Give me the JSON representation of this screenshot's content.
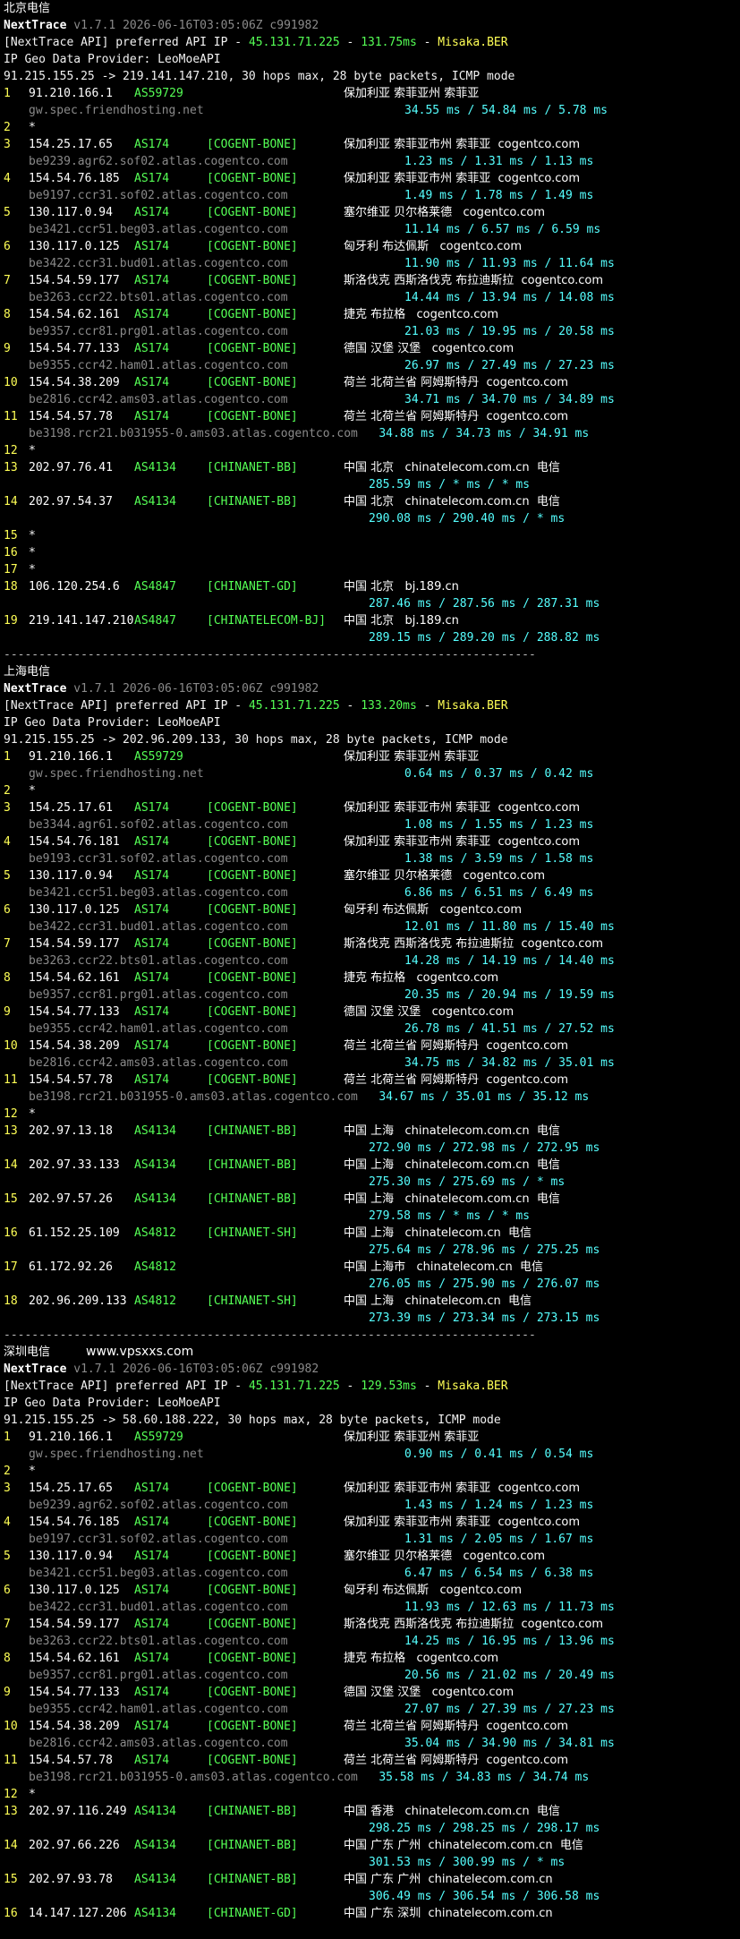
{
  "watermark": "www.vpsxxs.com",
  "sections": [
    {
      "title": "北京电信",
      "version_line": {
        "app": "NextTrace",
        "rest": " v1.7.1 2026-06-16T03:05:06Z c991982"
      },
      "api_line": {
        "prefix": "[NextTrace API]",
        "mid": " preferred API IP - ",
        "ip": "45.131.71.225",
        "dash": " - ",
        "latency": "131.75ms",
        "dash2": " - ",
        "node": "Misaka.BER"
      },
      "geo_provider": "IP Geo Data Provider: LeoMoeAPI",
      "trace_line": "91.215.155.25 -> 219.141.147.210, 30 hops max, 28 byte packets, ICMP mode",
      "hops": [
        {
          "n": "1",
          "ip": "91.210.166.1",
          "as": "AS59729",
          "tag": "",
          "geo": "保加利亚 索菲亚州 索菲亚",
          "host": "gw.spec.friendhosting.net",
          "rtt": "34.55 ms / 54.84 ms / 5.78 ms",
          "rtt_inline": false
        },
        {
          "n": "2",
          "star": "*"
        },
        {
          "n": "3",
          "ip": "154.25.17.65",
          "as": "AS174",
          "tag": "[COGENT-BONE]",
          "geo": "保加利亚 索菲亚市州 索菲亚  cogentco.com",
          "host": "be9239.agr62.sof02.atlas.cogentco.com",
          "rtt": "1.23 ms / 1.31 ms / 1.13 ms",
          "rtt_inline": false
        },
        {
          "n": "4",
          "ip": "154.54.76.185",
          "as": "AS174",
          "tag": "[COGENT-BONE]",
          "geo": "保加利亚 索菲亚市州 索菲亚  cogentco.com",
          "host": "be9197.ccr31.sof02.atlas.cogentco.com",
          "rtt": "1.49 ms / 1.78 ms / 1.49 ms",
          "rtt_inline": false
        },
        {
          "n": "5",
          "ip": "130.117.0.94",
          "as": "AS174",
          "tag": "[COGENT-BONE]",
          "geo": "塞尔维亚 贝尔格莱德   cogentco.com",
          "host": "be3421.ccr51.beg03.atlas.cogentco.com",
          "rtt": "11.14 ms / 6.57 ms / 6.59 ms",
          "rtt_inline": false
        },
        {
          "n": "6",
          "ip": "130.117.0.125",
          "as": "AS174",
          "tag": "[COGENT-BONE]",
          "geo": "匈牙利 布达佩斯   cogentco.com",
          "host": "be3422.ccr31.bud01.atlas.cogentco.com",
          "rtt": "11.90 ms / 11.93 ms / 11.64 ms",
          "rtt_inline": false
        },
        {
          "n": "7",
          "ip": "154.54.59.177",
          "as": "AS174",
          "tag": "[COGENT-BONE]",
          "geo": "斯洛伐克 西斯洛伐克 布拉迪斯拉  cogentco.com",
          "host": "be3263.ccr22.bts01.atlas.cogentco.com",
          "rtt": "14.44 ms / 13.94 ms / 14.08 ms",
          "rtt_inline": false
        },
        {
          "n": "8",
          "ip": "154.54.62.161",
          "as": "AS174",
          "tag": "[COGENT-BONE]",
          "geo": "捷克 布拉格   cogentco.com",
          "host": "be9357.ccr81.prg01.atlas.cogentco.com",
          "rtt": "21.03 ms / 19.95 ms / 20.58 ms",
          "rtt_inline": false
        },
        {
          "n": "9",
          "ip": "154.54.77.133",
          "as": "AS174",
          "tag": "[COGENT-BONE]",
          "geo": "德国 汉堡 汉堡   cogentco.com",
          "host": "be9355.ccr42.ham01.atlas.cogentco.com",
          "rtt": "26.97 ms / 27.49 ms / 27.23 ms",
          "rtt_inline": false
        },
        {
          "n": "10",
          "ip": "154.54.38.209",
          "as": "AS174",
          "tag": "[COGENT-BONE]",
          "geo": "荷兰 北荷兰省 阿姆斯特丹  cogentco.com",
          "host": "be2816.ccr42.ams03.atlas.cogentco.com",
          "rtt": "34.71 ms / 34.70 ms / 34.89 ms",
          "rtt_inline": false
        },
        {
          "n": "11",
          "ip": "154.54.57.78",
          "as": "AS174",
          "tag": "[COGENT-BONE]",
          "geo": "荷兰 北荷兰省 阿姆斯特丹  cogentco.com",
          "host": "be3198.rcr21.b031955-0.ams03.atlas.cogentco.com",
          "rtt": "34.88 ms / 34.73 ms / 34.91 ms",
          "rtt_inline": true
        },
        {
          "n": "12",
          "star": "*"
        },
        {
          "n": "13",
          "ip": "202.97.76.41",
          "as": "AS4134",
          "tag": "[CHINANET-BB]",
          "geo": "中国 北京   chinatelecom.com.cn  电信",
          "host": "",
          "rtt": "285.59 ms / * ms / * ms",
          "rtt_inline": false
        },
        {
          "n": "14",
          "ip": "202.97.54.37",
          "as": "AS4134",
          "tag": "[CHINANET-BB]",
          "geo": "中国 北京   chinatelecom.com.cn  电信",
          "host": "",
          "rtt": "290.08 ms / 290.40 ms / * ms",
          "rtt_inline": false
        },
        {
          "n": "15",
          "star": "*"
        },
        {
          "n": "16",
          "star": "*"
        },
        {
          "n": "17",
          "star": "*"
        },
        {
          "n": "18",
          "ip": "106.120.254.6",
          "as": "AS4847",
          "tag": "[CHINANET-GD]",
          "geo": "中国 北京   bj.189.cn",
          "host": "",
          "rtt": "287.46 ms / 287.56 ms / 287.31 ms",
          "rtt_inline": false
        },
        {
          "n": "19",
          "ip": "219.141.147.210",
          "as": "AS4847",
          "tag": "[CHINATELECOM-BJ]",
          "geo": "中国 北京   bj.189.cn",
          "host": "",
          "rtt": "289.15 ms / 289.20 ms / 288.82 ms",
          "rtt_inline": false
        }
      ]
    },
    {
      "title": "上海电信",
      "version_line": {
        "app": "NextTrace",
        "rest": " v1.7.1 2026-06-16T03:05:06Z c991982"
      },
      "api_line": {
        "prefix": "[NextTrace API]",
        "mid": " preferred API IP - ",
        "ip": "45.131.71.225",
        "dash": " - ",
        "latency": "133.20ms",
        "dash2": " - ",
        "node": "Misaka.BER"
      },
      "geo_provider": "IP Geo Data Provider: LeoMoeAPI",
      "trace_line": "91.215.155.25 -> 202.96.209.133, 30 hops max, 28 byte packets, ICMP mode",
      "hops": [
        {
          "n": "1",
          "ip": "91.210.166.1",
          "as": "AS59729",
          "tag": "",
          "geo": "保加利亚 索菲亚州 索菲亚",
          "host": "gw.spec.friendhosting.net",
          "rtt": "0.64 ms / 0.37 ms / 0.42 ms",
          "rtt_inline": false
        },
        {
          "n": "2",
          "star": "*"
        },
        {
          "n": "3",
          "ip": "154.25.17.61",
          "as": "AS174",
          "tag": "[COGENT-BONE]",
          "geo": "保加利亚 索菲亚市州 索菲亚  cogentco.com",
          "host": "be3344.agr61.sof02.atlas.cogentco.com",
          "rtt": "1.08 ms / 1.55 ms / 1.23 ms",
          "rtt_inline": false
        },
        {
          "n": "4",
          "ip": "154.54.76.181",
          "as": "AS174",
          "tag": "[COGENT-BONE]",
          "geo": "保加利亚 索菲亚市州 索菲亚  cogentco.com",
          "host": "be9193.ccr31.sof02.atlas.cogentco.com",
          "rtt": "1.38 ms / 3.59 ms / 1.58 ms",
          "rtt_inline": false
        },
        {
          "n": "5",
          "ip": "130.117.0.94",
          "as": "AS174",
          "tag": "[COGENT-BONE]",
          "geo": "塞尔维亚 贝尔格莱德   cogentco.com",
          "host": "be3421.ccr51.beg03.atlas.cogentco.com",
          "rtt": "6.86 ms / 6.51 ms / 6.49 ms",
          "rtt_inline": false
        },
        {
          "n": "6",
          "ip": "130.117.0.125",
          "as": "AS174",
          "tag": "[COGENT-BONE]",
          "geo": "匈牙利 布达佩斯   cogentco.com",
          "host": "be3422.ccr31.bud01.atlas.cogentco.com",
          "rtt": "12.01 ms / 11.80 ms / 15.40 ms",
          "rtt_inline": false
        },
        {
          "n": "7",
          "ip": "154.54.59.177",
          "as": "AS174",
          "tag": "[COGENT-BONE]",
          "geo": "斯洛伐克 西斯洛伐克 布拉迪斯拉  cogentco.com",
          "host": "be3263.ccr22.bts01.atlas.cogentco.com",
          "rtt": "14.28 ms / 14.19 ms / 14.40 ms",
          "rtt_inline": false
        },
        {
          "n": "8",
          "ip": "154.54.62.161",
          "as": "AS174",
          "tag": "[COGENT-BONE]",
          "geo": "捷克 布拉格   cogentco.com",
          "host": "be9357.ccr81.prg01.atlas.cogentco.com",
          "rtt": "20.35 ms / 20.94 ms / 19.59 ms",
          "rtt_inline": false
        },
        {
          "n": "9",
          "ip": "154.54.77.133",
          "as": "AS174",
          "tag": "[COGENT-BONE]",
          "geo": "德国 汉堡 汉堡   cogentco.com",
          "host": "be9355.ccr42.ham01.atlas.cogentco.com",
          "rtt": "26.78 ms / 41.51 ms / 27.52 ms",
          "rtt_inline": false
        },
        {
          "n": "10",
          "ip": "154.54.38.209",
          "as": "AS174",
          "tag": "[COGENT-BONE]",
          "geo": "荷兰 北荷兰省 阿姆斯特丹  cogentco.com",
          "host": "be2816.ccr42.ams03.atlas.cogentco.com",
          "rtt": "34.75 ms / 34.82 ms / 35.01 ms",
          "rtt_inline": false
        },
        {
          "n": "11",
          "ip": "154.54.57.78",
          "as": "AS174",
          "tag": "[COGENT-BONE]",
          "geo": "荷兰 北荷兰省 阿姆斯特丹  cogentco.com",
          "host": "be3198.rcr21.b031955-0.ams03.atlas.cogentco.com",
          "rtt": "34.67 ms / 35.01 ms / 35.12 ms",
          "rtt_inline": true
        },
        {
          "n": "12",
          "star": "*"
        },
        {
          "n": "13",
          "ip": "202.97.13.18",
          "as": "AS4134",
          "tag": "[CHINANET-BB]",
          "geo": "中国 上海   chinatelecom.com.cn  电信",
          "host": "",
          "rtt": "272.90 ms / 272.98 ms / 272.95 ms",
          "rtt_inline": false
        },
        {
          "n": "14",
          "ip": "202.97.33.133",
          "as": "AS4134",
          "tag": "[CHINANET-BB]",
          "geo": "中国 上海   chinatelecom.com.cn  电信",
          "host": "",
          "rtt": "275.30 ms / 275.69 ms / * ms",
          "rtt_inline": false
        },
        {
          "n": "15",
          "ip": "202.97.57.26",
          "as": "AS4134",
          "tag": "[CHINANET-BB]",
          "geo": "中国 上海   chinatelecom.com.cn  电信",
          "host": "",
          "rtt": "279.58 ms / * ms / * ms",
          "rtt_inline": false
        },
        {
          "n": "16",
          "ip": "61.152.25.109",
          "as": "AS4812",
          "tag": "[CHINANET-SH]",
          "geo": "中国 上海   chinatelecom.cn  电信",
          "host": "",
          "rtt": "275.64 ms / 278.96 ms / 275.25 ms",
          "rtt_inline": false
        },
        {
          "n": "17",
          "ip": "61.172.92.26",
          "as": "AS4812",
          "tag": "",
          "geo": "中国 上海市   chinatelecom.cn  电信",
          "host": "",
          "rtt": "276.05 ms / 275.90 ms / 276.07 ms",
          "rtt_inline": false
        },
        {
          "n": "18",
          "ip": "202.96.209.133",
          "as": "AS4812",
          "tag": "[CHINANET-SH]",
          "geo": "中国 上海   chinatelecom.cn  电信",
          "host": "",
          "rtt": "273.39 ms / 273.34 ms / 273.15 ms",
          "rtt_inline": false
        }
      ]
    },
    {
      "title": "深圳电信",
      "version_line": {
        "app": "NextTrace",
        "rest": " v1.7.1 2026-06-16T03:05:06Z c991982"
      },
      "api_line": {
        "prefix": "[NextTrace API]",
        "mid": " preferred API IP - ",
        "ip": "45.131.71.225",
        "dash": " - ",
        "latency": "129.53ms",
        "dash2": " - ",
        "node": "Misaka.BER"
      },
      "geo_provider": "IP Geo Data Provider: LeoMoeAPI",
      "trace_line": "91.215.155.25 -> 58.60.188.222, 30 hops max, 28 byte packets, ICMP mode",
      "hops": [
        {
          "n": "1",
          "ip": "91.210.166.1",
          "as": "AS59729",
          "tag": "",
          "geo": "保加利亚 索菲亚州 索菲亚",
          "host": "gw.spec.friendhosting.net",
          "rtt": "0.90 ms / 0.41 ms / 0.54 ms",
          "rtt_inline": false
        },
        {
          "n": "2",
          "star": "*"
        },
        {
          "n": "3",
          "ip": "154.25.17.65",
          "as": "AS174",
          "tag": "[COGENT-BONE]",
          "geo": "保加利亚 索菲亚市州 索菲亚  cogentco.com",
          "host": "be9239.agr62.sof02.atlas.cogentco.com",
          "rtt": "1.43 ms / 1.24 ms / 1.23 ms",
          "rtt_inline": false
        },
        {
          "n": "4",
          "ip": "154.54.76.185",
          "as": "AS174",
          "tag": "[COGENT-BONE]",
          "geo": "保加利亚 索菲亚市州 索菲亚  cogentco.com",
          "host": "be9197.ccr31.sof02.atlas.cogentco.com",
          "rtt": "1.31 ms / 2.05 ms / 1.67 ms",
          "rtt_inline": false
        },
        {
          "n": "5",
          "ip": "130.117.0.94",
          "as": "AS174",
          "tag": "[COGENT-BONE]",
          "geo": "塞尔维亚 贝尔格莱德   cogentco.com",
          "host": "be3421.ccr51.beg03.atlas.cogentco.com",
          "rtt": "6.47 ms / 6.54 ms / 6.38 ms",
          "rtt_inline": false
        },
        {
          "n": "6",
          "ip": "130.117.0.125",
          "as": "AS174",
          "tag": "[COGENT-BONE]",
          "geo": "匈牙利 布达佩斯   cogentco.com",
          "host": "be3422.ccr31.bud01.atlas.cogentco.com",
          "rtt": "11.93 ms / 12.63 ms / 11.73 ms",
          "rtt_inline": false
        },
        {
          "n": "7",
          "ip": "154.54.59.177",
          "as": "AS174",
          "tag": "[COGENT-BONE]",
          "geo": "斯洛伐克 西斯洛伐克 布拉迪斯拉  cogentco.com",
          "host": "be3263.ccr22.bts01.atlas.cogentco.com",
          "rtt": "14.25 ms / 16.95 ms / 13.96 ms",
          "rtt_inline": false
        },
        {
          "n": "8",
          "ip": "154.54.62.161",
          "as": "AS174",
          "tag": "[COGENT-BONE]",
          "geo": "捷克 布拉格   cogentco.com",
          "host": "be9357.ccr81.prg01.atlas.cogentco.com",
          "rtt": "20.56 ms / 21.02 ms / 20.49 ms",
          "rtt_inline": false
        },
        {
          "n": "9",
          "ip": "154.54.77.133",
          "as": "AS174",
          "tag": "[COGENT-BONE]",
          "geo": "德国 汉堡 汉堡   cogentco.com",
          "host": "be9355.ccr42.ham01.atlas.cogentco.com",
          "rtt": "27.07 ms / 27.39 ms / 27.23 ms",
          "rtt_inline": false
        },
        {
          "n": "10",
          "ip": "154.54.38.209",
          "as": "AS174",
          "tag": "[COGENT-BONE]",
          "geo": "荷兰 北荷兰省 阿姆斯特丹  cogentco.com",
          "host": "be2816.ccr42.ams03.atlas.cogentco.com",
          "rtt": "35.04 ms / 34.90 ms / 34.81 ms",
          "rtt_inline": false
        },
        {
          "n": "11",
          "ip": "154.54.57.78",
          "as": "AS174",
          "tag": "[COGENT-BONE]",
          "geo": "荷兰 北荷兰省 阿姆斯特丹  cogentco.com",
          "host": "be3198.rcr21.b031955-0.ams03.atlas.cogentco.com",
          "rtt": "35.58 ms / 34.83 ms / 34.74 ms",
          "rtt_inline": true
        },
        {
          "n": "12",
          "star": "*"
        },
        {
          "n": "13",
          "ip": "202.97.116.249",
          "as": "AS4134",
          "tag": "[CHINANET-BB]",
          "geo": "中国 香港   chinatelecom.com.cn  电信",
          "host": "",
          "rtt": "298.25 ms / 298.25 ms / 298.17 ms",
          "rtt_inline": false
        },
        {
          "n": "14",
          "ip": "202.97.66.226",
          "as": "AS4134",
          "tag": "[CHINANET-BB]",
          "geo": "中国 广东 广州  chinatelecom.com.cn  电信",
          "host": "",
          "rtt": "301.53 ms / 300.99 ms / * ms",
          "rtt_inline": false
        },
        {
          "n": "15",
          "ip": "202.97.93.78",
          "as": "AS4134",
          "tag": "[CHINANET-BB]",
          "geo": "中国 广东 广州  chinatelecom.com.cn",
          "host": "",
          "rtt": "306.49 ms / 306.54 ms / 306.58 ms",
          "rtt_inline": false
        },
        {
          "n": "16",
          "ip": "14.147.127.206",
          "as": "AS4134",
          "tag": "[CHINANET-GD]",
          "geo": "中国 广东 深圳  chinatelecom.com.cn",
          "host": "",
          "rtt": "",
          "rtt_inline": false
        }
      ]
    }
  ],
  "separator": "----------------------------------------------------------------------------"
}
